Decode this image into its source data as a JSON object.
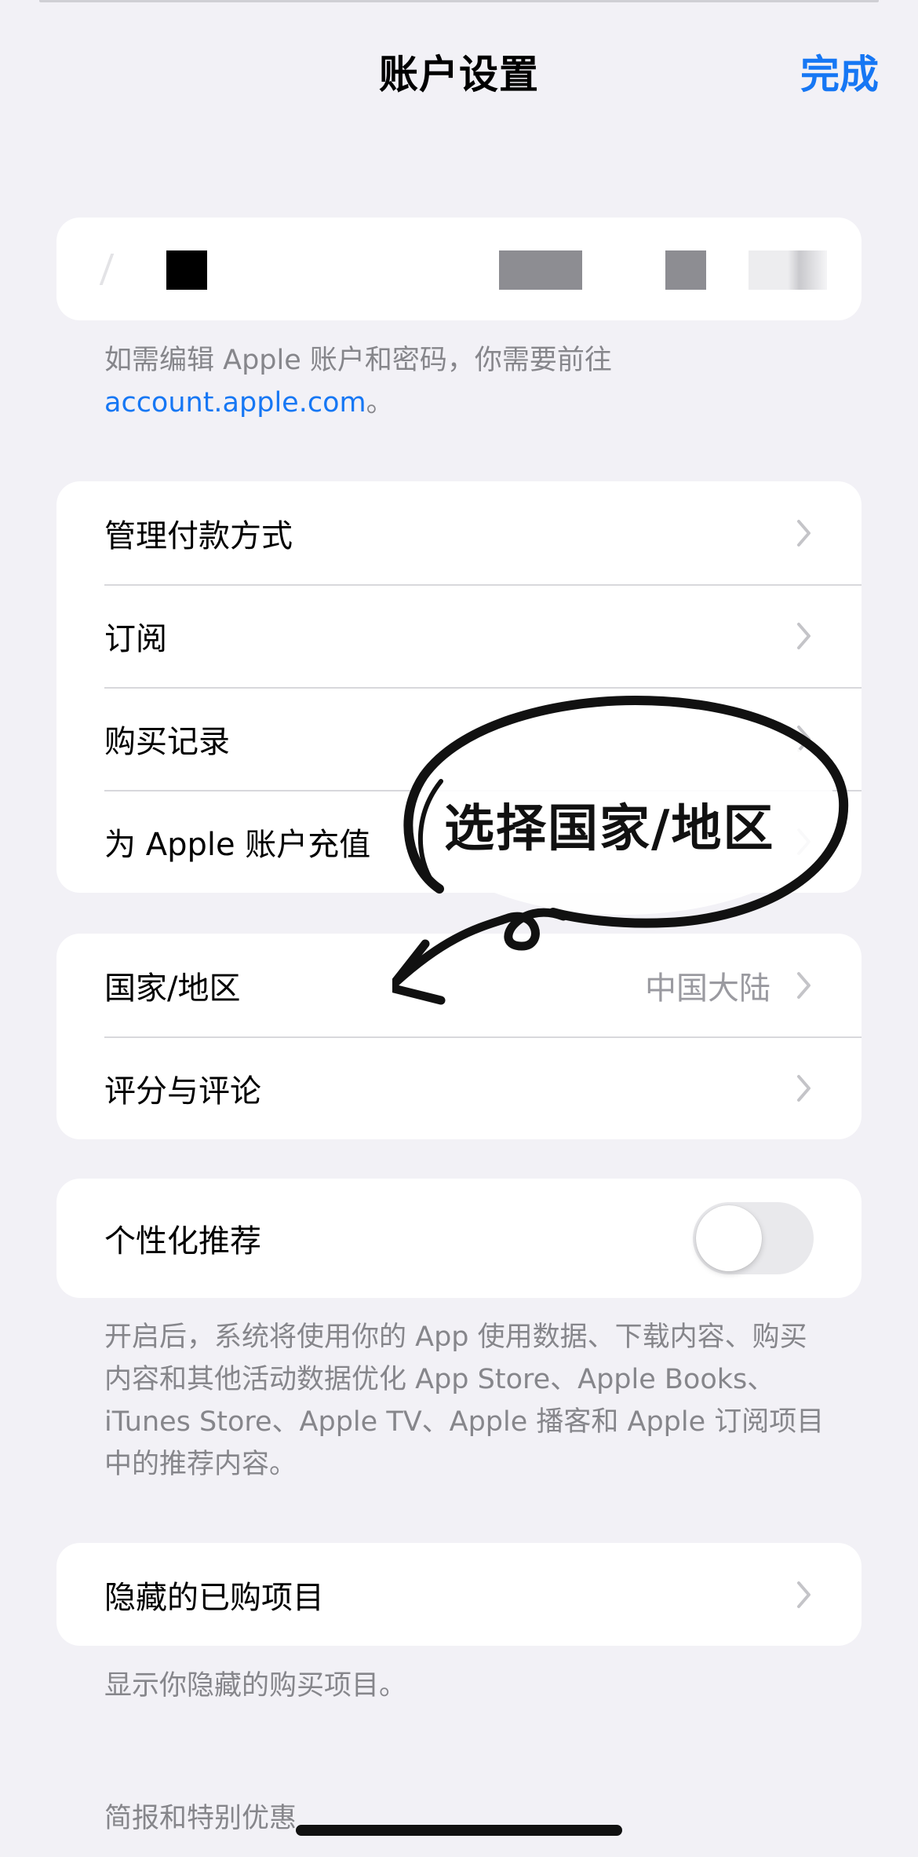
{
  "nav": {
    "title": "账户设置",
    "done_label": "完成"
  },
  "account_note": {
    "text": "如需编辑 Apple 账户和密码，你需要前往",
    "link": "account.apple.com",
    "suffix": "。"
  },
  "group1": {
    "items": [
      {
        "label": "管理付款方式"
      },
      {
        "label": "订阅"
      },
      {
        "label": "购买记录"
      },
      {
        "label": "为 Apple 账户充值"
      }
    ]
  },
  "group2": {
    "items": [
      {
        "label": "国家/地区",
        "value": "中国大陆"
      },
      {
        "label": "评分与评论"
      }
    ]
  },
  "personalization": {
    "label": "个性化推荐",
    "enabled": false,
    "footer": "开启后，系统将使用你的 App 使用数据、下载内容、购买内容和其他活动数据优化 App Store、Apple Books、iTunes Store、Apple TV、Apple 播客和 Apple 订阅项目中的推荐内容。"
  },
  "hidden_purchases": {
    "label": "隐藏的已购项目",
    "footer": "显示你隐藏的购买项目。"
  },
  "newsletter": {
    "label": "简报和特别优惠"
  },
  "annotation": {
    "text": "选择国家/地区"
  },
  "colors": {
    "accent": "#1677f4",
    "background": "#f2f1f6",
    "secondary_text": "#86868b"
  }
}
